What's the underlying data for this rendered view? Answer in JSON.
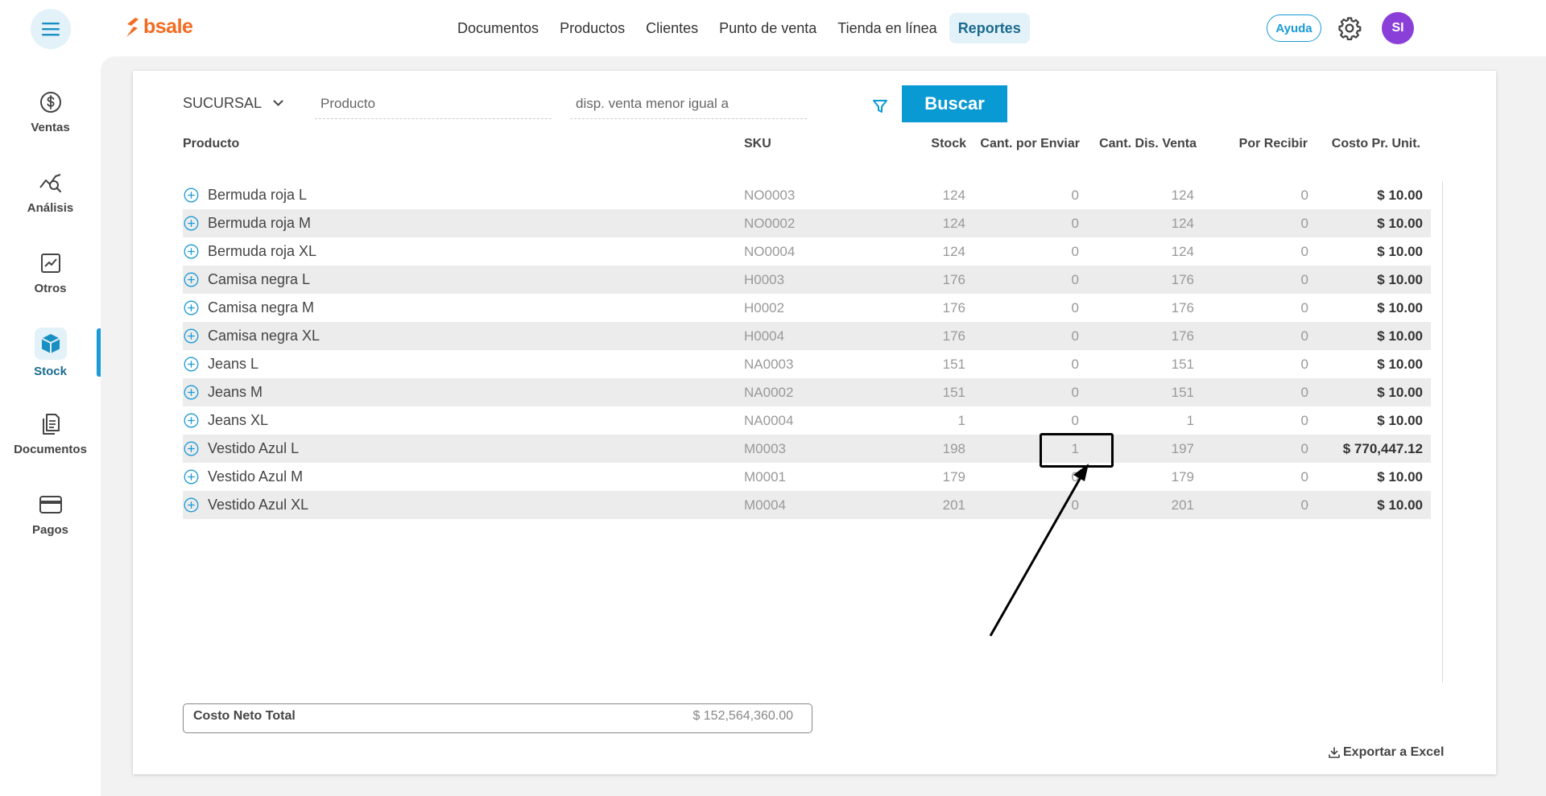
{
  "brand": {
    "name": "bsale",
    "color": "#f26b21"
  },
  "nav": {
    "items": [
      {
        "label": "Documentos",
        "active": false
      },
      {
        "label": "Productos",
        "active": false
      },
      {
        "label": "Clientes",
        "active": false
      },
      {
        "label": "Punto de venta",
        "active": false
      },
      {
        "label": "Tienda en línea",
        "active": false
      },
      {
        "label": "Reportes",
        "active": true
      }
    ]
  },
  "header": {
    "help_label": "Ayuda",
    "avatar_initials": "SI"
  },
  "sidebar": {
    "items": [
      {
        "label": "Ventas",
        "icon": "dollar-circle-icon",
        "active": false
      },
      {
        "label": "Análisis",
        "icon": "analytics-search-icon",
        "active": false
      },
      {
        "label": "Otros",
        "icon": "chart-square-icon",
        "active": false
      },
      {
        "label": "Stock",
        "icon": "box-icon",
        "active": true
      },
      {
        "label": "Documentos",
        "icon": "documents-icon",
        "active": false
      },
      {
        "label": "Pagos",
        "icon": "credit-card-icon",
        "active": false
      }
    ]
  },
  "filters": {
    "branch_label": "SUCURSAL",
    "product_placeholder": "Producto",
    "disp_placeholder": "disp. venta menor igual a",
    "search_label": "Buscar"
  },
  "table": {
    "columns": {
      "product": "Producto",
      "sku": "SKU",
      "stock": "Stock",
      "to_send": "Cant. por Enviar",
      "available": "Cant. Dis. Venta",
      "to_receive": "Por Recibir",
      "unit_cost": "Costo Pr. Unit."
    },
    "rows": [
      {
        "name": "Bermuda roja L",
        "sku": "NO0003",
        "stock": "124",
        "to_send": "0",
        "available": "124",
        "to_receive": "0",
        "unit_cost": "$ 10.00"
      },
      {
        "name": "Bermuda roja M",
        "sku": "NO0002",
        "stock": "124",
        "to_send": "0",
        "available": "124",
        "to_receive": "0",
        "unit_cost": "$ 10.00"
      },
      {
        "name": "Bermuda roja XL",
        "sku": "NO0004",
        "stock": "124",
        "to_send": "0",
        "available": "124",
        "to_receive": "0",
        "unit_cost": "$ 10.00"
      },
      {
        "name": "Camisa negra L",
        "sku": "H0003",
        "stock": "176",
        "to_send": "0",
        "available": "176",
        "to_receive": "0",
        "unit_cost": "$ 10.00"
      },
      {
        "name": "Camisa negra M",
        "sku": "H0002",
        "stock": "176",
        "to_send": "0",
        "available": "176",
        "to_receive": "0",
        "unit_cost": "$ 10.00"
      },
      {
        "name": "Camisa negra XL",
        "sku": "H0004",
        "stock": "176",
        "to_send": "0",
        "available": "176",
        "to_receive": "0",
        "unit_cost": "$ 10.00"
      },
      {
        "name": "Jeans L",
        "sku": "NA0003",
        "stock": "151",
        "to_send": "0",
        "available": "151",
        "to_receive": "0",
        "unit_cost": "$ 10.00"
      },
      {
        "name": "Jeans M",
        "sku": "NA0002",
        "stock": "151",
        "to_send": "0",
        "available": "151",
        "to_receive": "0",
        "unit_cost": "$ 10.00"
      },
      {
        "name": "Jeans XL",
        "sku": "NA0004",
        "stock": "1",
        "to_send": "0",
        "available": "1",
        "to_receive": "0",
        "unit_cost": "$ 10.00"
      },
      {
        "name": "Vestido Azul L",
        "sku": "M0003",
        "stock": "198",
        "to_send": "1",
        "available": "197",
        "to_receive": "0",
        "unit_cost": "$ 770,447.12"
      },
      {
        "name": "Vestido Azul M",
        "sku": "M0001",
        "stock": "179",
        "to_send": "0",
        "available": "179",
        "to_receive": "0",
        "unit_cost": "$ 10.00"
      },
      {
        "name": "Vestido Azul XL",
        "sku": "M0004",
        "stock": "201",
        "to_send": "0",
        "available": "201",
        "to_receive": "0",
        "unit_cost": "$ 10.00"
      }
    ]
  },
  "totals": {
    "label": "Costo Neto Total",
    "value": "$ 152,564,360.00"
  },
  "export_label": "Exportar a Excel"
}
